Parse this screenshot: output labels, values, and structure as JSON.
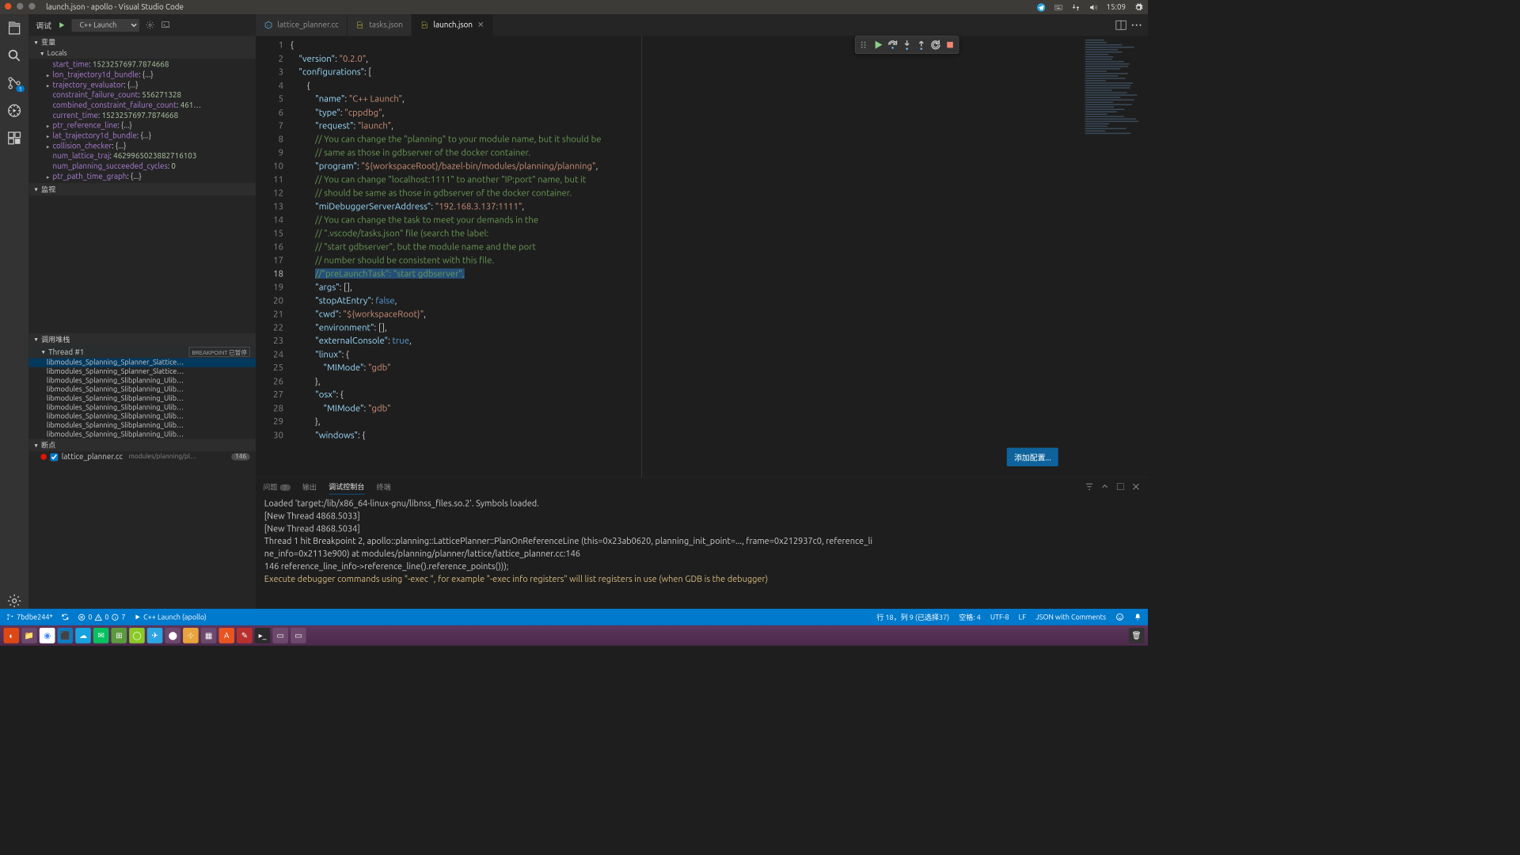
{
  "os": {
    "title": "launch.json - apollo - Visual Studio Code",
    "time": "15:09"
  },
  "debug": {
    "title": "调试",
    "config": "C++ Launch",
    "sections": {
      "variables": "变量",
      "locals": "Locals",
      "watch": "监视",
      "callstack": "调用堆栈",
      "breakpoints": "断点"
    },
    "locals": [
      {
        "expand": false,
        "k": "start_time",
        "v": "1523257697.7874668"
      },
      {
        "expand": true,
        "k": "lon_trajectory1d_bundle",
        "v": "{...}"
      },
      {
        "expand": true,
        "k": "trajectory_evaluator",
        "v": "{...}"
      },
      {
        "expand": false,
        "k": "constraint_failure_count",
        "v": "556271328"
      },
      {
        "expand": false,
        "k": "combined_constraint_failure_count",
        "v": "461…"
      },
      {
        "expand": false,
        "k": "current_time",
        "v": "1523257697.7874668"
      },
      {
        "expand": true,
        "k": "ptr_reference_line",
        "v": "{...}"
      },
      {
        "expand": true,
        "k": "lat_trajectory1d_bundle",
        "v": "{...}"
      },
      {
        "expand": true,
        "k": "collision_checker",
        "v": "{...}"
      },
      {
        "expand": false,
        "k": "num_lattice_traj",
        "v": "4629965023882716103"
      },
      {
        "expand": false,
        "k": "num_planning_succeeded_cycles",
        "v": "0"
      },
      {
        "expand": true,
        "k": "ptr_path_time_graph",
        "v": "{...}"
      }
    ],
    "thread": {
      "name": "Thread #1",
      "state": "BREAKPOINT 已暂停"
    },
    "frames": [
      "libmodules_Splanning_Splanner_Slattice…",
      "libmodules_Splanning_Splanner_Slattice…",
      "libmodules_Splanning_Slibplanning_Ulib…",
      "libmodules_Splanning_Slibplanning_Ulib…",
      "libmodules_Splanning_Slibplanning_Ulib…",
      "libmodules_Splanning_Slibplanning_Ulib…",
      "libmodules_Splanning_Slibplanning_Ulib…",
      "libmodules_Splanning_Slibplanning_Ulib…",
      "libmodules_Splanning_Slibplanning_Ulib…"
    ],
    "breakpoint": {
      "file": "lattice_planner.cc",
      "path": "modules/planning/pl…",
      "line": "146"
    }
  },
  "tabs": [
    {
      "icon": "cpp",
      "label": "lattice_planner.cc",
      "active": false
    },
    {
      "icon": "json",
      "label": "tasks.json",
      "active": false
    },
    {
      "icon": "json",
      "label": "launch.json",
      "active": true
    }
  ],
  "editor": {
    "lines": 30,
    "addConfig": "添加配置..."
  },
  "panel": {
    "tabs": {
      "problems": "问题",
      "problemsCount": "7",
      "output": "输出",
      "debugConsole": "调试控制台",
      "terminal": "终端"
    },
    "lines": [
      "Loaded 'target:/lib/x86_64-linux-gnu/libnss_files.so.2'. Symbols loaded.",
      "[New Thread 4868.5033]",
      "[New Thread 4868.5034]",
      "",
      "Thread 1 hit Breakpoint 2, apollo::planning::LatticePlanner::PlanOnReferenceLine (this=0x23ab0620, planning_init_point=..., frame=0x212937c0, reference_li",
      "ne_info=0x2113e900) at modules/planning/planner/lattice/lattice_planner.cc:146",
      "146               reference_line_info->reference_line().reference_points()));"
    ],
    "hint": "Execute debugger commands using \"-exec <command>\", for example \"-exec info registers\" will list registers in use (when GDB is the debugger)"
  },
  "status": {
    "branch": "7bdbe244*",
    "errors": "0",
    "warnings": "0",
    "info": "7",
    "launch": "C++ Launch (apollo)",
    "pos": "行 18，列 9 (已选择37)",
    "spaces": "空格: 4",
    "enc": "UTF-8",
    "eol": "LF",
    "lang": "JSON with Comments"
  }
}
